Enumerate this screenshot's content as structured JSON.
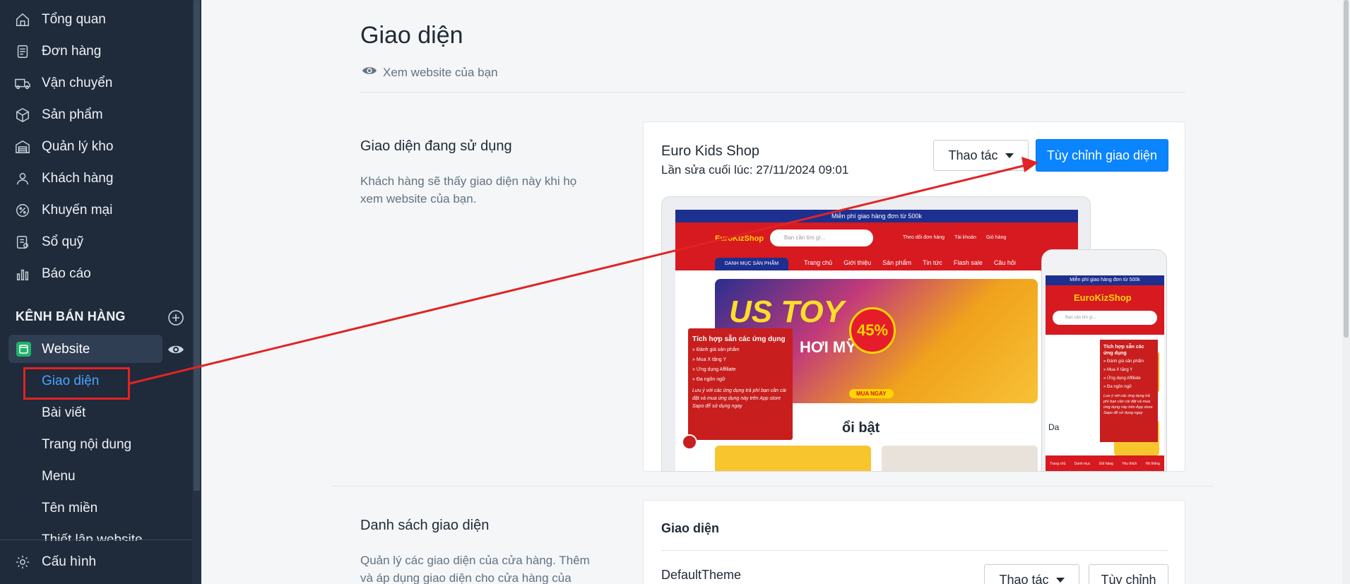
{
  "sidebar": {
    "items": [
      {
        "label": "Tổng quan",
        "icon": "home-icon"
      },
      {
        "label": "Đơn hàng",
        "icon": "orders-icon"
      },
      {
        "label": "Vận chuyển",
        "icon": "truck-icon"
      },
      {
        "label": "Sản phẩm",
        "icon": "box-icon"
      },
      {
        "label": "Quản lý kho",
        "icon": "warehouse-icon"
      },
      {
        "label": "Khách hàng",
        "icon": "user-icon"
      },
      {
        "label": "Khuyến mại",
        "icon": "discount-icon"
      },
      {
        "label": "Sổ quỹ",
        "icon": "ledger-icon"
      },
      {
        "label": "Báo cáo",
        "icon": "chart-icon"
      }
    ],
    "sales_channels_label": "KÊNH BÁN HÀNG",
    "website_label": "Website",
    "website_subitems": [
      {
        "label": "Giao diện",
        "active": true
      },
      {
        "label": "Bài viết",
        "active": false
      },
      {
        "label": "Trang nội dung",
        "active": false
      },
      {
        "label": "Menu",
        "active": false
      },
      {
        "label": "Tên miền",
        "active": false
      },
      {
        "label": "Thiết lập website",
        "active": false
      }
    ],
    "settings_label": "Cấu hình"
  },
  "main": {
    "title": "Giao diện",
    "view_website": "Xem website của bạn",
    "current_theme": {
      "section_title": "Giao diện đang sử dụng",
      "section_desc": "Khách hàng sẽ thấy giao diện này khi họ xem website của bạn.",
      "name": "Euro Kids Shop",
      "last_edited": "Lần sửa cuối lúc: 27/11/2024 09:01",
      "actions_label": "Thao tác",
      "customize_label": "Tùy chỉnh giao diện"
    },
    "theme_list": {
      "section_title": "Danh sách giao diện",
      "section_desc": "Quản lý các giao diện của cửa hàng. Thêm và áp dụng giao diện cho cửa hàng của",
      "card_title": "Giao diện",
      "theme_name": "DefaultTheme",
      "actions_label": "Thao tác",
      "customize_label": "Tùy chỉnh"
    }
  },
  "preview": {
    "topbar": "Miễn phí giao hàng đơn từ 500k",
    "logo": "EuroKizShop",
    "search_placeholder": "Bạn cần tìm gì...",
    "header_links": [
      "Theo dõi đơn hàng",
      "Tài khoản",
      "Giỏ hàng"
    ],
    "nav_category": "DANH MỤC SẢN PHẨM",
    "nav_links": [
      "Trang chủ",
      "Giới thiệu",
      "Sản phẩm",
      "Tin tức",
      "Flash sale",
      "Câu hỏi"
    ],
    "banner_big": "US TOY",
    "banner_mid": "HƠI MỸ",
    "banner_badge": "45%",
    "banner_cta": "MUA NGAY",
    "section_title": "ổi bật",
    "popup_title": "Tích hợp sẵn các ứng dụng",
    "popup_items": [
      "Đánh giá sản phẩm",
      "Mua X tặng Y",
      "Ứng dụng Affiliate",
      "Đa ngôn ngữ"
    ],
    "popup_note": "Lưu ý với các ứng dụng trả phí bạn cần cài đặt và mua ứng dụng này trên App store Sapo để sử dụng ngay",
    "phone_da": "Da",
    "phone_bottom": [
      "Trang chủ",
      "Danh mục",
      "Giỏ hàng",
      "Yêu thích",
      "Hệ thống"
    ]
  },
  "colors": {
    "sidebar_bg": "#1f2a3a",
    "accent": "#0a84ff",
    "active_link": "#4aa3ff",
    "annotation": "#e02424"
  }
}
